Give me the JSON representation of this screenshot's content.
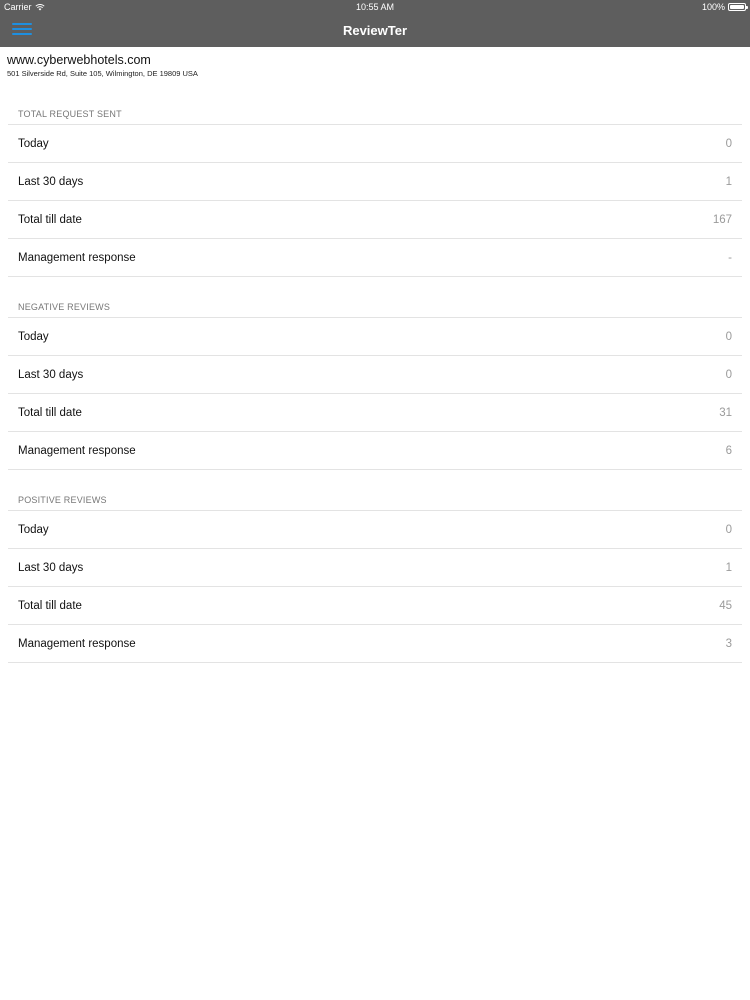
{
  "status_bar": {
    "carrier": "Carrier",
    "wifi_icon": "wifi-icon",
    "time": "10:55 AM",
    "battery": "100%",
    "battery_icon": "battery-icon"
  },
  "nav": {
    "menu_icon": "hamburger-menu-icon",
    "menu_icon_color": "#1e8fe0",
    "title": "ReviewTer",
    "bar_color": "#5e5e5e"
  },
  "hotel": {
    "name": "www.cyberwebhotels.com",
    "address": "501 Silverside Rd, Suite 105, Wilmington, DE 19809 USA"
  },
  "sections": [
    {
      "title": "TOTAL REQUEST SENT",
      "rows": [
        {
          "label": "Today",
          "value": "0"
        },
        {
          "label": "Last 30 days",
          "value": "1"
        },
        {
          "label": "Total till date",
          "value": "167"
        },
        {
          "label": "Management response",
          "value": "-"
        }
      ]
    },
    {
      "title": "NEGATIVE REVIEWS",
      "rows": [
        {
          "label": "Today",
          "value": "0"
        },
        {
          "label": "Last 30 days",
          "value": "0"
        },
        {
          "label": "Total till date",
          "value": "31"
        },
        {
          "label": "Management response",
          "value": "6"
        }
      ]
    },
    {
      "title": "POSITIVE REVIEWS",
      "rows": [
        {
          "label": "Today",
          "value": "0"
        },
        {
          "label": "Last 30 days",
          "value": "1"
        },
        {
          "label": "Total till date",
          "value": "45"
        },
        {
          "label": "Management response",
          "value": "3"
        }
      ]
    }
  ]
}
